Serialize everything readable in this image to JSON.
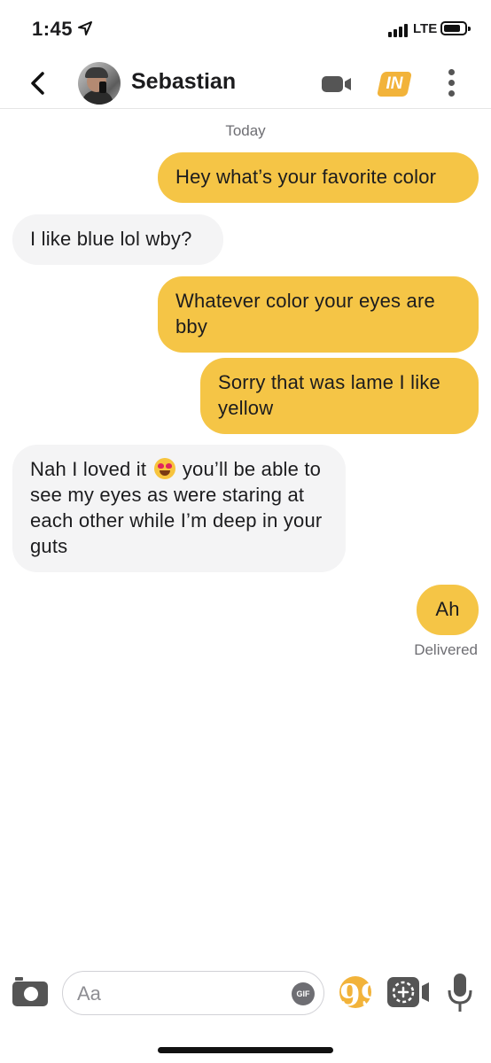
{
  "status_bar": {
    "time": "1:45",
    "network": "LTE"
  },
  "header": {
    "contact_name": "Sebastian",
    "game_badge": "IN",
    "icons": [
      "back-chevron-icon",
      "video-call-icon",
      "game-icon",
      "more-options-icon"
    ]
  },
  "conversation": {
    "day_label": "Today",
    "messages": [
      {
        "from": "me",
        "text": "Hey what’s your favorite color"
      },
      {
        "from": "them",
        "text": "I like blue lol wby?"
      },
      {
        "from": "me",
        "text": "Whatever color your eyes are bby"
      },
      {
        "from": "me",
        "text": "Sorry that was lame I like yellow"
      },
      {
        "from": "them",
        "text_before": "Nah I loved it",
        "emoji": "heart-eyes-emoji",
        "text_after": "you’ll be able to see my eyes as were staring at each other while I’m deep in your guts"
      },
      {
        "from": "me",
        "text": "Ah"
      }
    ],
    "receipt": "Delivered"
  },
  "composer": {
    "placeholder": "Aa",
    "gif_label": "GIF",
    "quote_label": "99",
    "icons": [
      "camera-icon",
      "gif-icon",
      "quote-icon",
      "camera-plus-icon",
      "microphone-icon"
    ]
  },
  "colors": {
    "outgoing_bubble": "#f5c546",
    "incoming_bubble": "#f4f4f5",
    "accent": "#f2b33a"
  }
}
